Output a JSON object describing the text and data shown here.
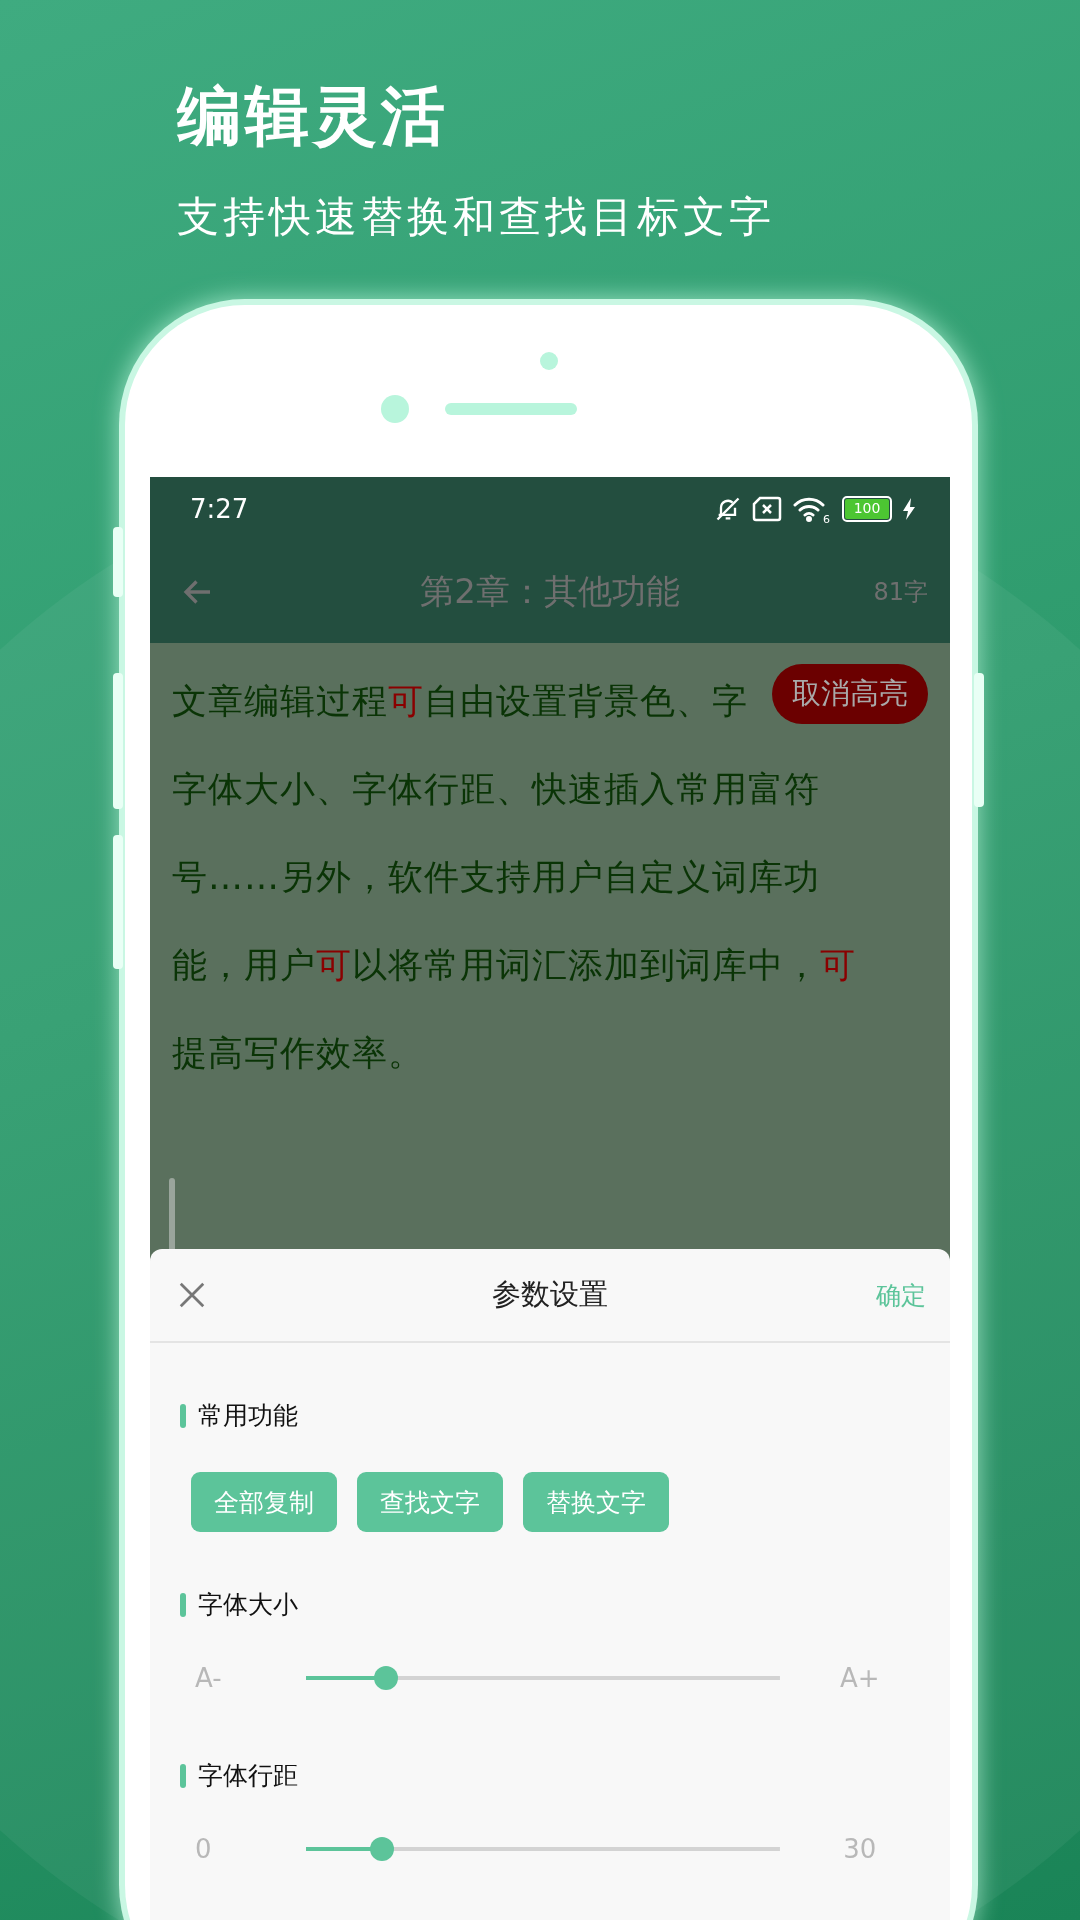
{
  "headline": {
    "title": "编辑灵活",
    "subtitle": "支持快速替换和查找目标文字"
  },
  "status_bar": {
    "time": "7:27",
    "battery": "100",
    "wifi_badge": "6"
  },
  "toolbar": {
    "title": "第2章：其他功能",
    "count": "81字"
  },
  "editor": {
    "lines": [
      [
        {
          "text": "文章编辑过程",
          "highlight": false
        },
        {
          "text": "可",
          "highlight": true
        },
        {
          "text": "自由设置背景色、字",
          "highlight": false
        }
      ],
      [
        {
          "text": "字体大小、字体行距、快速插入常用富符",
          "highlight": false
        }
      ],
      [
        {
          "text": "号……另外，软件支持用户自定义词库功",
          "highlight": false
        }
      ],
      [
        {
          "text": "能，用户",
          "highlight": false
        },
        {
          "text": "可",
          "highlight": true
        },
        {
          "text": "以将常用词汇添加到词库中，",
          "highlight": false
        },
        {
          "text": "可",
          "highlight": true
        }
      ],
      [
        {
          "text": "提高写作效率。",
          "highlight": false
        }
      ]
    ],
    "clear_highlight_button": "取消高亮"
  },
  "sheet": {
    "title": "参数设置",
    "confirm": "确定",
    "sections": [
      {
        "kind": "buttons",
        "label": "常用功能",
        "buttons": [
          "全部复制",
          "查找文字",
          "替换文字"
        ]
      },
      {
        "kind": "slider",
        "label": "字体大小",
        "min_label": "A-",
        "max_label": "A+",
        "level": 0.17
      },
      {
        "kind": "slider",
        "label": "字体行距",
        "min_label": "0",
        "max_label": "30",
        "level": 0.16
      }
    ]
  }
}
